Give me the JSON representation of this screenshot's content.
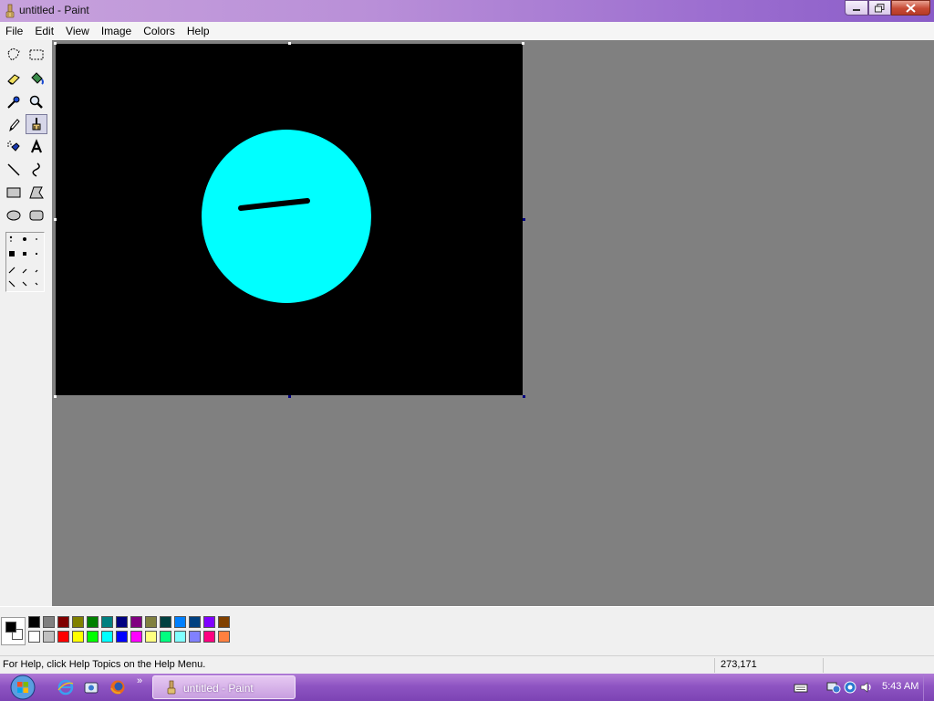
{
  "window": {
    "title": "untitled - Paint"
  },
  "menu": {
    "items": [
      "File",
      "Edit",
      "View",
      "Image",
      "Colors",
      "Help"
    ]
  },
  "toolbox": {
    "tools": [
      "free-form-select",
      "rect-select",
      "eraser",
      "fill-with-color",
      "pick-color",
      "magnifier",
      "pencil",
      "brush",
      "airbrush",
      "text",
      "line",
      "curve",
      "rectangle",
      "polygon",
      "ellipse",
      "rounded-rectangle"
    ],
    "active_tool": "brush"
  },
  "canvas": {
    "background": "#000000",
    "circle_color": "#00ffff",
    "stroke_color": "#000000"
  },
  "palette": {
    "foreground": "#000000",
    "background": "#ffffff",
    "row1": [
      "#000000",
      "#808080",
      "#800000",
      "#808000",
      "#008000",
      "#008080",
      "#000080",
      "#800080",
      "#808040",
      "#004040",
      "#0080ff",
      "#004080",
      "#8000ff",
      "#804000"
    ],
    "row2": [
      "#ffffff",
      "#c0c0c0",
      "#ff0000",
      "#ffff00",
      "#00ff00",
      "#00ffff",
      "#0000ff",
      "#ff00ff",
      "#ffff80",
      "#00ff80",
      "#80ffff",
      "#8080ff",
      "#ff0080",
      "#ff8040"
    ]
  },
  "status": {
    "help_text": "For Help, click Help Topics on the Help Menu.",
    "coordinates": "273,171"
  },
  "taskbar": {
    "task_label": "untitled - Paint",
    "more_symbol": "»",
    "clock": "5:43 AM"
  }
}
